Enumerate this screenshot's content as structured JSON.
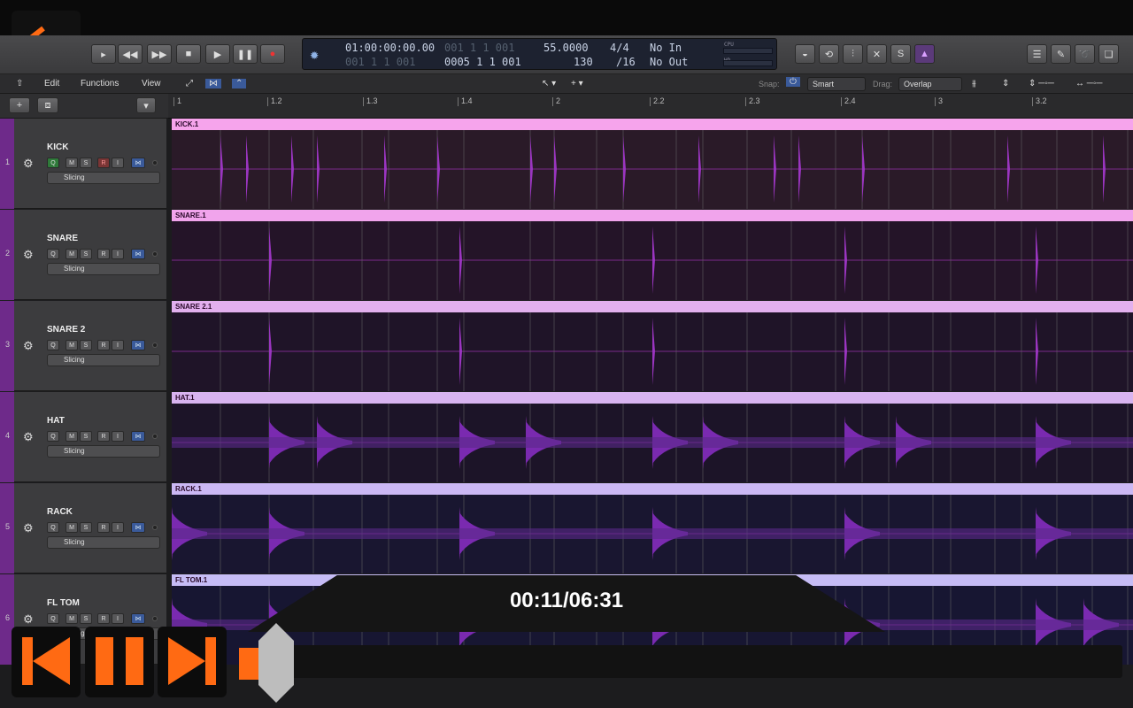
{
  "accent": "#ff6a13",
  "transport": {
    "buttons": [
      "rewind-icon",
      "fast-forward-icon",
      "stop-icon",
      "play-icon",
      "pause-icon",
      "record-icon"
    ],
    "lcd": {
      "time": "01:00:00:00.00",
      "bars_dim_top": "001 1 1 001",
      "bars_dim_bot": "0005 1 1 001",
      "bars": "001 1 1 001",
      "tempo_top": "55.0000",
      "tempo": "130",
      "sig": "4/4",
      "div": "/16",
      "in": "No In",
      "out": "No Out",
      "cpu": "CPU",
      "hd": "HD"
    }
  },
  "menu": {
    "edit": "Edit",
    "functions": "Functions",
    "view": "View",
    "snap_label": "Snap:",
    "snap_value": "Smart",
    "drag_label": "Drag:",
    "drag_value": "Overlap"
  },
  "ruler": [
    "1",
    "1.2",
    "1.3",
    "1.4",
    "2",
    "2.2",
    "2.3",
    "2.4",
    "3",
    "3.2"
  ],
  "tracks": [
    {
      "num": "1",
      "name": "KICK",
      "region": "KICK.1",
      "mode": "Slicing",
      "head": "#f6a4ec",
      "body": "#2a1a28"
    },
    {
      "num": "2",
      "name": "SNARE",
      "region": "SNARE.1",
      "mode": "Slicing",
      "head": "#f1a4ec",
      "body": "#241428"
    },
    {
      "num": "3",
      "name": "SNARE 2",
      "region": "SNARE 2.1",
      "mode": "Slicing",
      "head": "#e2b0ee",
      "body": "#1f1428"
    },
    {
      "num": "4",
      "name": "HAT",
      "region": "HAT.1",
      "mode": "Slicing",
      "head": "#d8b4f0",
      "body": "#1c1428"
    },
    {
      "num": "5",
      "name": "RACK",
      "region": "RACK.1",
      "mode": "Slicing",
      "head": "#cbb8f4",
      "body": "#191630"
    },
    {
      "num": "6",
      "name": "FL TOM",
      "region": "FL TOM.1",
      "mode": "Slicing",
      "head": "#c6bcf6",
      "body": "#171632"
    }
  ],
  "player": {
    "time": "00:11/06:31",
    "progress": 0.03
  }
}
